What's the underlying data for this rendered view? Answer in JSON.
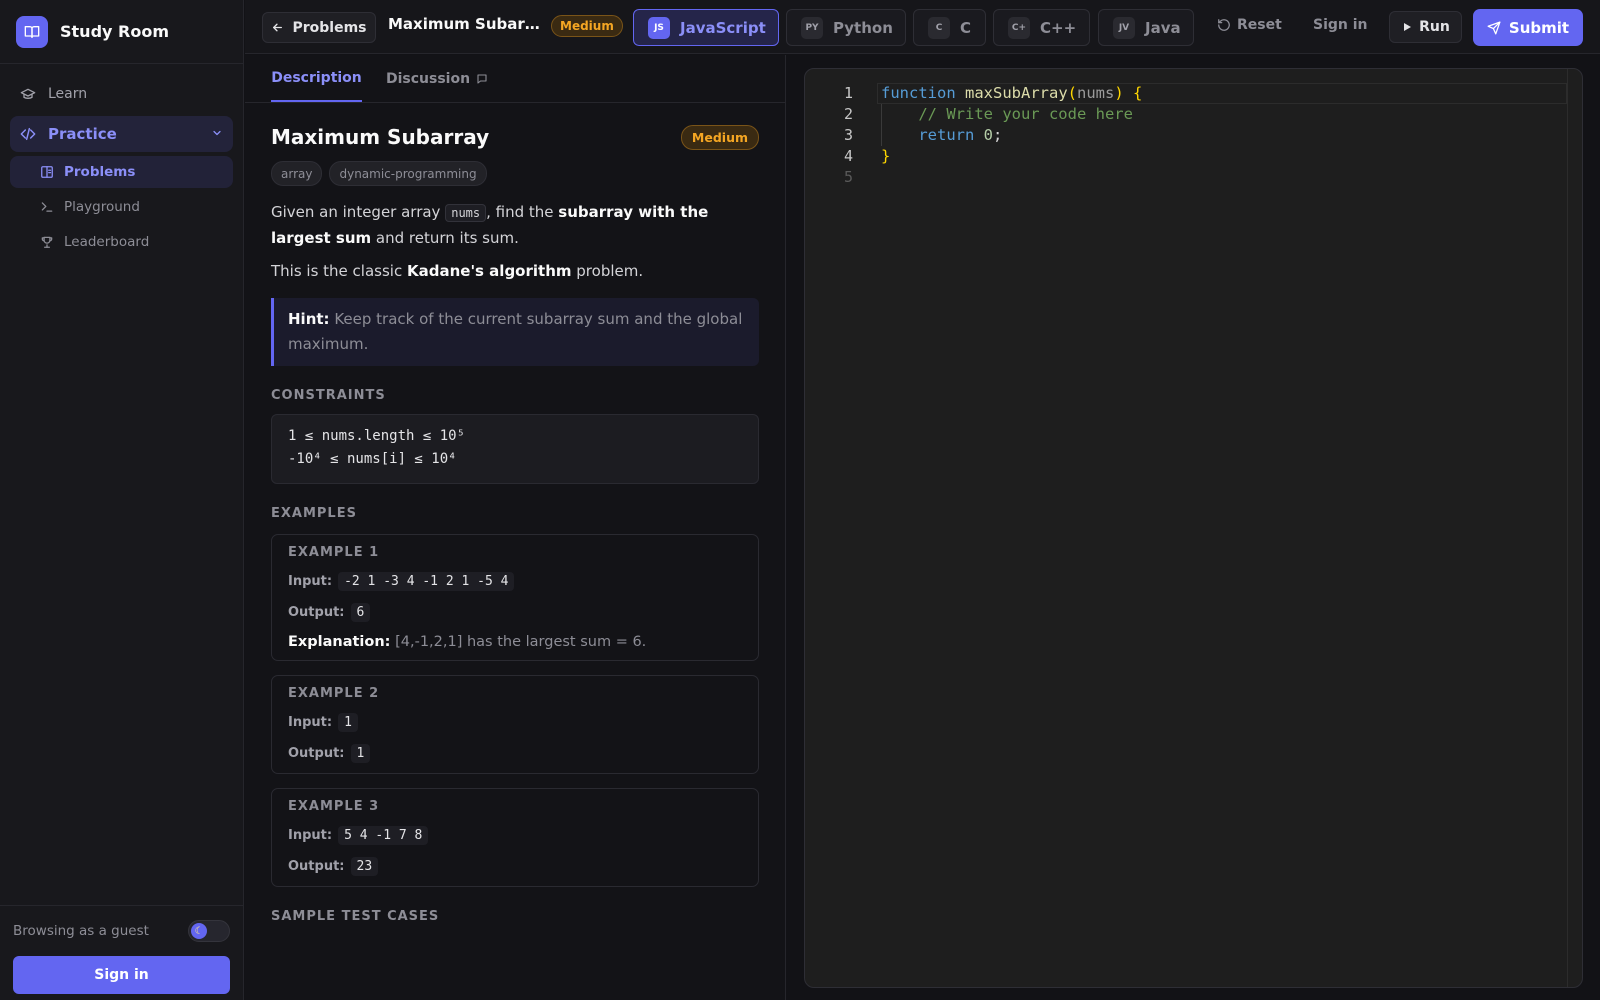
{
  "app": {
    "name": "Study Room",
    "logo_icon": "book-open-icon",
    "accent_color": "#6366f1"
  },
  "sidebar": {
    "items": [
      {
        "label": "Learn",
        "icon": "graduation-cap-icon"
      },
      {
        "label": "Practice",
        "icon": "code-icon",
        "expanded": true
      }
    ],
    "practice_children": [
      {
        "label": "Problems",
        "icon": "book-icon",
        "active": true
      },
      {
        "label": "Playground",
        "icon": "terminal-icon"
      },
      {
        "label": "Leaderboard",
        "icon": "trophy-icon"
      }
    ],
    "footer": {
      "guest_label": "Browsing as a guest",
      "theme_toggle_icon": "moon-icon",
      "signin_label": "Sign in"
    }
  },
  "topbar": {
    "back_label": "Problems",
    "problem_title": "Maximum Subarray",
    "difficulty": "Medium",
    "languages": [
      {
        "code": "JS",
        "label": "JavaScript",
        "active": true
      },
      {
        "code": "PY",
        "label": "Python"
      },
      {
        "code": "C",
        "label": "C"
      },
      {
        "code": "C+",
        "label": "C++"
      },
      {
        "code": "JV",
        "label": "Java"
      }
    ],
    "reset_label": "Reset",
    "signin_label": "Sign in",
    "run_label": "Run",
    "submit_label": "Submit"
  },
  "panel": {
    "tabs": [
      {
        "label": "Description",
        "active": true
      },
      {
        "label": "Discussion",
        "icon": "comment-icon"
      }
    ],
    "title": "Maximum Subarray",
    "difficulty": "Medium",
    "tags": [
      "array",
      "dynamic-programming"
    ],
    "description": {
      "p1_pre": "Given an integer array ",
      "p1_code": "nums",
      "p1_mid": ", find the ",
      "p1_bold": "subarray with the largest sum",
      "p1_post": " and return its sum.",
      "p2_pre": "This is the classic ",
      "p2_bold": "Kadane's algorithm",
      "p2_post": " problem."
    },
    "hint": {
      "label": "Hint:",
      "text": "Keep track of the current subarray sum and the global maximum."
    },
    "constraints_title": "CONSTRAINTS",
    "constraints": [
      "1 ≤ nums.length ≤ 10⁵",
      "-10⁴ ≤ nums[i] ≤ 10⁴"
    ],
    "examples_title": "EXAMPLES",
    "input_label": "Input:",
    "output_label": "Output:",
    "explanation_label": "Explanation:",
    "examples": [
      {
        "title": "EXAMPLE 1",
        "input": "-2 1 -3 4 -1 2 1 -5 4",
        "output": "6",
        "explanation": "[4,-1,2,1] has the largest sum = 6."
      },
      {
        "title": "EXAMPLE 2",
        "input": "1",
        "output": "1"
      },
      {
        "title": "EXAMPLE 3",
        "input": "5 4 -1 7 8",
        "output": "23"
      }
    ],
    "sample_title": "SAMPLE TEST CASES"
  },
  "editor": {
    "line_numbers": [
      "1",
      "2",
      "3",
      "4",
      "5"
    ],
    "code": {
      "l1_kw": "function",
      "l1_fn": "maxSubArray",
      "l1_open": "(",
      "l1_param": "nums",
      "l1_close": ")",
      "l1_brace": "{",
      "l2_comment": "// Write your code here",
      "l3_kw": "return",
      "l3_num": "0",
      "l3_semi": ";",
      "l4_brace": "}"
    }
  }
}
